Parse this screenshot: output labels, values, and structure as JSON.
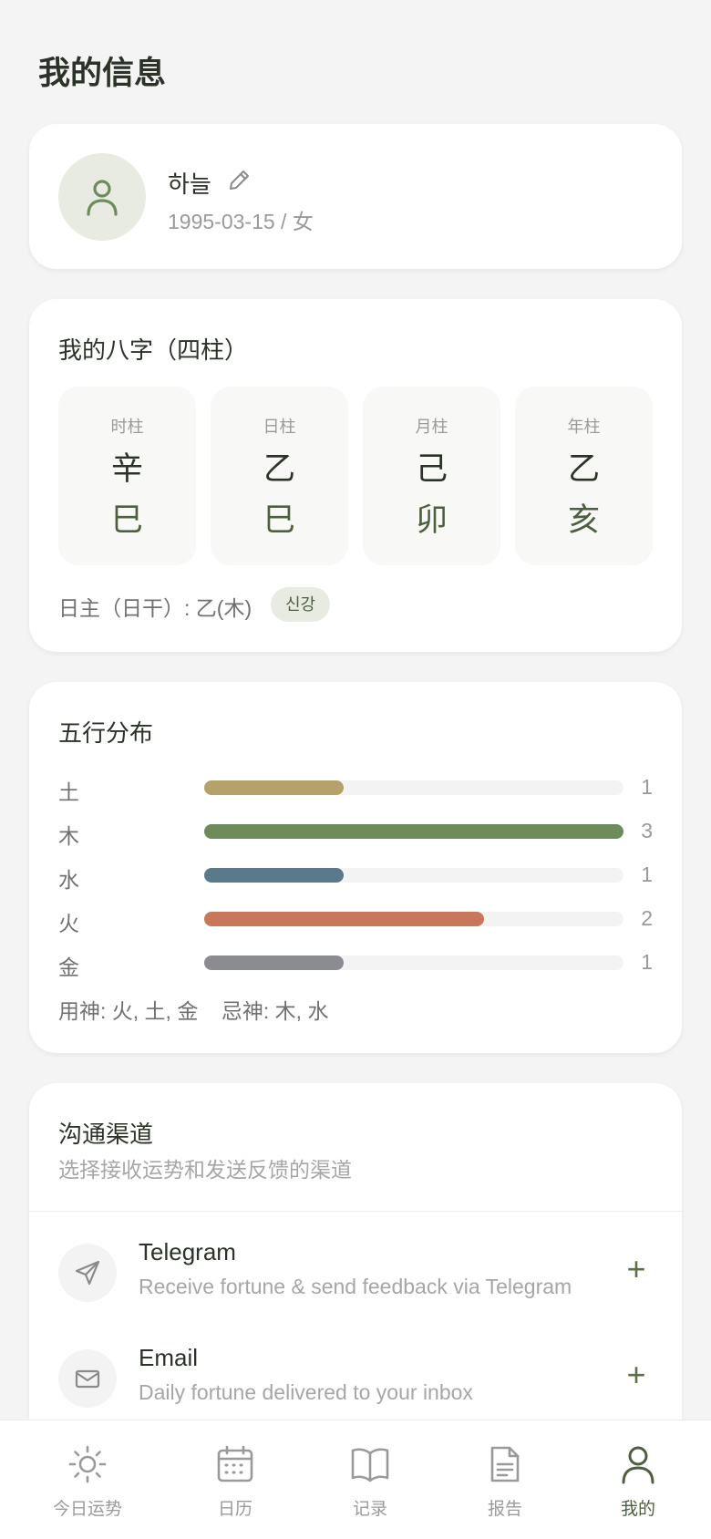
{
  "page": {
    "title": "我的信息"
  },
  "profile": {
    "name": "하늘",
    "sub": "1995-03-15 / 女",
    "avatar_icon": "user-icon",
    "edit_icon": "pencil-icon"
  },
  "bazi": {
    "title": "我的八字（四柱）",
    "pillars": [
      {
        "label": "时柱",
        "stem": "辛",
        "branch": "巳"
      },
      {
        "label": "日柱",
        "stem": "乙",
        "branch": "巳"
      },
      {
        "label": "月柱",
        "stem": "己",
        "branch": "卯"
      },
      {
        "label": "年柱",
        "stem": "乙",
        "branch": "亥"
      }
    ],
    "daymaster": "日主（日干）: 乙(木)",
    "badge": "신강"
  },
  "wuxing": {
    "title": "五行分布",
    "max": 3,
    "elements": [
      {
        "label": "土",
        "count": "1",
        "value": 1,
        "color": "#b5a26a"
      },
      {
        "label": "木",
        "count": "3",
        "value": 3,
        "color": "#6e8c5a"
      },
      {
        "label": "水",
        "count": "1",
        "value": 1,
        "color": "#5a7a8c"
      },
      {
        "label": "火",
        "count": "2",
        "value": 2,
        "color": "#c8775a"
      },
      {
        "label": "金",
        "count": "1",
        "value": 1,
        "color": "#8a8c92"
      }
    ],
    "yongshen": "用神: 火, 土, 金    忌神: 木, 水"
  },
  "channels": {
    "title": "沟通渠道",
    "subtitle": "选择接收运势和发送反馈的渠道",
    "items": [
      {
        "name": "Telegram",
        "desc": "Receive fortune & send feedback via Telegram",
        "icon": "send-icon",
        "action": "+"
      },
      {
        "name": "Email",
        "desc": "Daily fortune delivered to your inbox",
        "icon": "mail-icon",
        "action": "+"
      }
    ]
  },
  "tabs": [
    {
      "label": "今日运势",
      "icon": "sun-icon",
      "active": false
    },
    {
      "label": "日历",
      "icon": "calendar-icon",
      "active": false
    },
    {
      "label": "记录",
      "icon": "book-icon",
      "active": false
    },
    {
      "label": "报告",
      "icon": "document-icon",
      "active": false
    },
    {
      "label": "我的",
      "icon": "user-icon",
      "active": true
    }
  ],
  "colors": {
    "accent": "#4c6040",
    "background": "#f4f4f4",
    "card": "#ffffff"
  }
}
